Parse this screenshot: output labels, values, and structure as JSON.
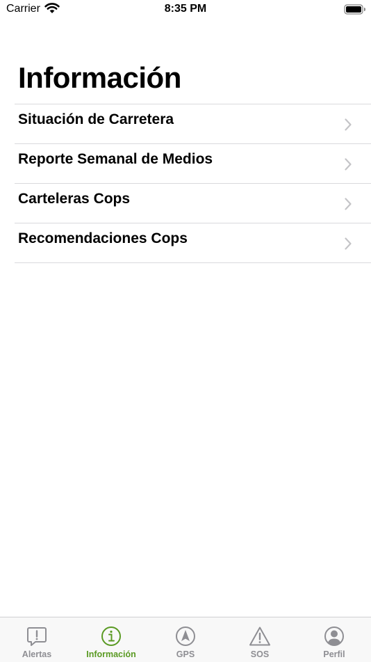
{
  "status_bar": {
    "carrier": "Carrier",
    "time": "8:35 PM"
  },
  "page": {
    "title": "Información"
  },
  "list": {
    "items": [
      {
        "label": "Situación de Carretera"
      },
      {
        "label": "Reporte Semanal de Medios"
      },
      {
        "label": "Carteleras Cops"
      },
      {
        "label": "Recomendaciones Cops"
      }
    ]
  },
  "tab_bar": {
    "active_color": "#5a9a23",
    "inactive_color": "#8e8e93",
    "tabs": [
      {
        "label": "Alertas",
        "icon": "alert-bubble-icon",
        "active": false
      },
      {
        "label": "Información",
        "icon": "info-icon",
        "active": true
      },
      {
        "label": "GPS",
        "icon": "navigation-icon",
        "active": false
      },
      {
        "label": "SOS",
        "icon": "warning-icon",
        "active": false
      },
      {
        "label": "Perfil",
        "icon": "profile-icon",
        "active": false
      }
    ]
  }
}
